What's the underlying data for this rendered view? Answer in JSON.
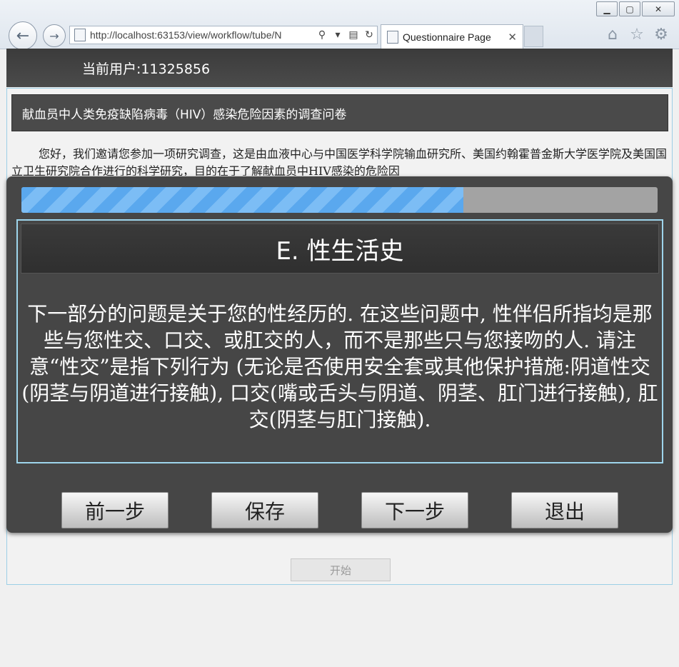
{
  "browser": {
    "url": "http://localhost:63153/view/workflow/tube/N",
    "tab_title": "Questionnaire Page",
    "tab_close": "✕",
    "win_minimize": "▁",
    "win_maximize": "▢",
    "win_close": "✕"
  },
  "header": {
    "user_label": "当前用户:11325856"
  },
  "survey": {
    "title": "献血员中人类免疫缺陷病毒（HIV）感染危险因素的调查问卷",
    "intro": "您好，我们邀请您参加一项研究调查，这是由血液中心与中国医学科学院输血研究所、美国约翰霍普金斯大学医学院及美国国立卫生研究院合作进行的科学研究，目的在于了解献血员中HIV感染的危险因",
    "start_label": "开始"
  },
  "modal": {
    "progress": 0.695,
    "section_title": "E. 性生活史",
    "section_body": "下一部分的问题是关于您的性经历的. 在这些问题中, 性伴侣所指均是那些与您性交、口交、或肛交的人，而不是那些只与您接吻的人. 请注意“性交”是指下列行为 (无论是否使用安全套或其他保护措施:阴道性交 (阴茎与阴道进行接触), 口交(嘴或舌头与阴道、阴茎、肛门进行接触), 肛交(阴茎与肛门接触).",
    "buttons": {
      "prev": "前一步",
      "save": "保存",
      "next": "下一步",
      "exit": "退出"
    }
  },
  "colors": {
    "progress_fill": "#5aa8ee",
    "modal_bg": "#464646",
    "section_border": "#9ed5ec"
  }
}
